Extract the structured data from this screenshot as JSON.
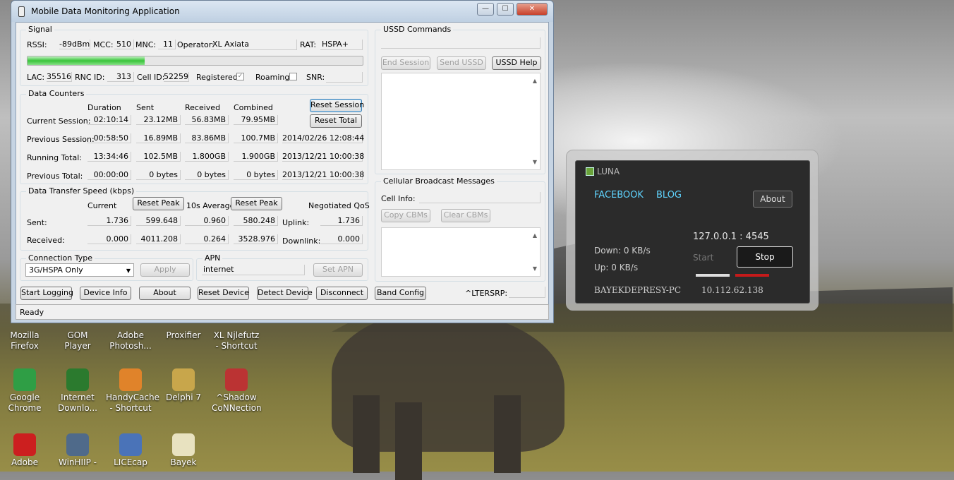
{
  "window": {
    "title": "Mobile Data Monitoring Application",
    "minimize": "—",
    "maximize": "☐",
    "close": "✕"
  },
  "signal": {
    "legend": "Signal",
    "rssi_label": "RSSI:",
    "rssi": "-89dBm",
    "mcc_label": "MCC:",
    "mcc": "510",
    "mnc_label": "MNC:",
    "mnc": "11",
    "operator_label": "Operator:",
    "operator": "XL Axiata",
    "rat_label": "RAT:",
    "rat": "HSPA+",
    "signal_level_percent": 35,
    "lac_label": "LAC:",
    "lac": "35516",
    "rnc_label": "RNC ID:",
    "rnc": "313",
    "cell_label": "Cell ID:",
    "cell": "52259",
    "registered_label": "Registered:",
    "registered": true,
    "registered_mark": "✓",
    "roaming_label": "Roaming:",
    "roaming": false,
    "snr_label": "SNR:"
  },
  "counters": {
    "legend": "Data Counters",
    "headers": [
      "Duration",
      "Sent",
      "Received",
      "Combined"
    ],
    "reset_session": "Reset Session",
    "reset_total": "Reset Total",
    "rows": [
      {
        "label": "Current Session:",
        "duration": "02:10:14",
        "sent": "23.12MB",
        "received": "56.83MB",
        "combined": "79.95MB",
        "date": ""
      },
      {
        "label": "Previous Session:",
        "duration": "00:58:50",
        "sent": "16.89MB",
        "received": "83.86MB",
        "combined": "100.7MB",
        "date": "2014/02/26 12:08:44"
      },
      {
        "label": "Running Total:",
        "duration": "13:34:46",
        "sent": "102.5MB",
        "received": "1.800GB",
        "combined": "1.900GB",
        "date": "2013/12/21 10:00:38"
      },
      {
        "label": "Previous Total:",
        "duration": "00:00:00",
        "sent": "0 bytes",
        "received": "0 bytes",
        "combined": "0 bytes",
        "date": "2013/12/21 10:00:38"
      }
    ]
  },
  "speed": {
    "legend": "Data Transfer Speed (kbps)",
    "current_header": "Current",
    "reset_peak": "Reset Peak",
    "avg_header": "10s Average",
    "qos_header": "Negotiated QoS",
    "sent_label": "Sent:",
    "received_label": "Received:",
    "sent": {
      "current": "1.736",
      "peak": "599.648",
      "avg": "0.960",
      "avg_peak": "580.248"
    },
    "received": {
      "current": "0.000",
      "peak": "4011.208",
      "avg": "0.264",
      "avg_peak": "3528.976"
    },
    "uplink_label": "Uplink:",
    "uplink": "1.736",
    "downlink_label": "Downlink:",
    "downlink": "0.000"
  },
  "connection": {
    "legend": "Connection Type",
    "selected": "3G/HSPA Only",
    "apply": "Apply"
  },
  "apn": {
    "legend": "APN",
    "value": "internet",
    "set": "Set APN"
  },
  "ussd": {
    "legend": "USSD Commands",
    "end_session": "End Session",
    "send_ussd": "Send USSD",
    "help": "USSD Help"
  },
  "cbm": {
    "legend": "Cellular Broadcast Messages",
    "cell_info_label": "Cell Info:",
    "copy": "Copy CBMs",
    "clear": "Clear CBMs"
  },
  "bottom_buttons": [
    "Start Logging",
    "Device Info",
    "About",
    "Reset Device",
    "Detect Device",
    "Disconnect",
    "Band Config"
  ],
  "at_command": "^LTERSRP:",
  "status": "Ready",
  "desktop_icons": [
    {
      "label": "Mozilla Firefox",
      "color": "#e76f1c"
    },
    {
      "label": "GOM Player",
      "color": "#2d6ab0"
    },
    {
      "label": "Adobe Photosh...",
      "color": "#1b3f7a"
    },
    {
      "label": "Proxifier",
      "color": "#3b7bbf"
    },
    {
      "label": "XL Njlefutz - Shortcut",
      "color": "#777777"
    },
    {
      "label": "Google Chrome",
      "color": "#2f9e45"
    },
    {
      "label": "Internet Downlo...",
      "color": "#2b7a2e"
    },
    {
      "label": "HandyCache - Shortcut",
      "color": "#e0832a"
    },
    {
      "label": "Delphi 7",
      "color": "#c8a64b"
    },
    {
      "label": "^Shadow CoNNection",
      "color": "#b33"
    },
    {
      "label": "Adobe",
      "color": "#cc1f1f"
    },
    {
      "label": "WinHIIP -",
      "color": "#4f6a8a"
    },
    {
      "label": "LICEcap",
      "color": "#4a73b8"
    },
    {
      "label": "Bayek",
      "color": "#e8e2c0"
    }
  ],
  "luna": {
    "title": "LUNA",
    "facebook": "FACEBOOK",
    "blog": "BLOG",
    "about": "About",
    "address": "127.0.0.1 : 4545",
    "down": "Down: 0 KB/s",
    "up": "Up: 0 KB/s",
    "start": "Start",
    "stop": "Stop",
    "host": "BAYEKDEPRESY-PC",
    "ip": "10.112.62.138"
  }
}
